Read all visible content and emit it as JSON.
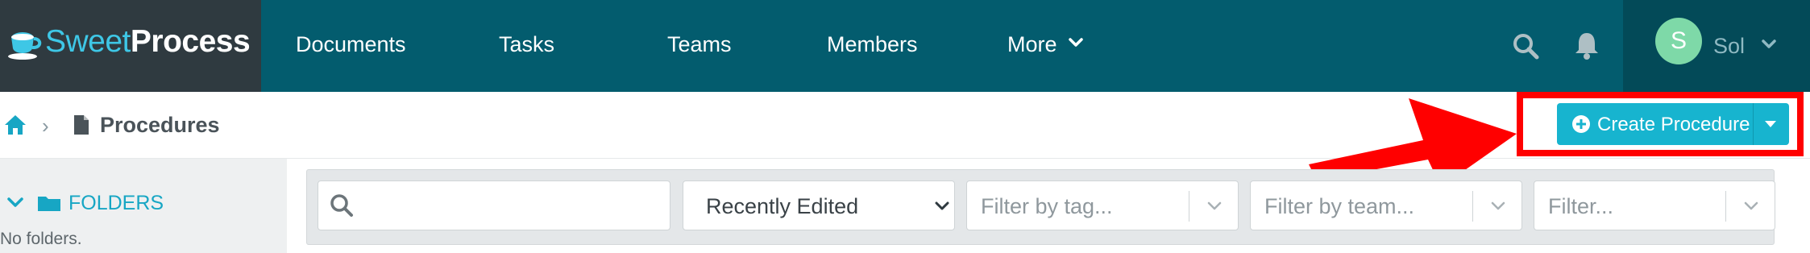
{
  "brand": {
    "name_light": "Sweet",
    "name_bold": "Process"
  },
  "nav": {
    "items": [
      "Documents",
      "Tasks",
      "Teams",
      "Members"
    ],
    "more_label": "More"
  },
  "icons": {
    "search": "search-icon",
    "notifications": "bell-icon",
    "home": "home-icon",
    "document": "document-icon",
    "folder": "folder-icon"
  },
  "user": {
    "initial": "S",
    "name": "Sol"
  },
  "breadcrumb": {
    "separator": "›",
    "title": "Procedures"
  },
  "create_button": {
    "label": "Create Procedure"
  },
  "sidebar": {
    "folders_label": "FOLDERS",
    "empty_text": "No folders."
  },
  "filters": {
    "search_value": "",
    "sort_value": "Recently Edited",
    "tag_placeholder": "Filter by tag...",
    "team_placeholder": "Filter by team...",
    "other_placeholder": "Filter..."
  },
  "colors": {
    "nav_bg": "#035c6e",
    "brand_bg": "#2f3a40",
    "accent": "#17b4cf",
    "annotation_red": "#ff0000",
    "avatar": "#7ed9a8"
  }
}
